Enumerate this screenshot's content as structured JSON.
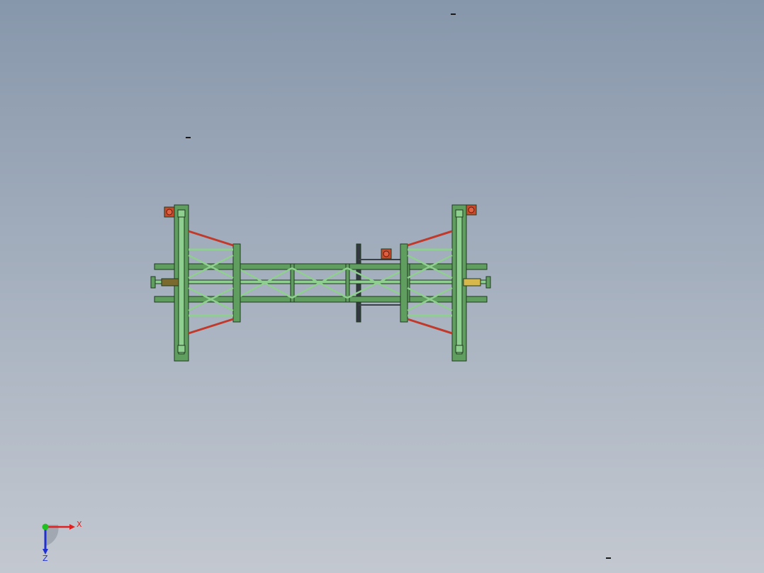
{
  "viewport": {
    "background_top": "#8797ab",
    "background_bottom": "#c3c8d0"
  },
  "model": {
    "frame_color": "#5f9e5f",
    "frame_light": "#8fcf8f",
    "outline_color": "#1e3a1e",
    "brace_red": "#c0392b",
    "clamp_left_color": "#7a6a2e",
    "clamp_right_color": "#d8b84a",
    "bolt_color": "#c94a2a"
  },
  "triad": {
    "x_label": "X",
    "z_label": "Z",
    "x_color": "#e02020",
    "y_color": "#20c020",
    "z_color": "#2030d0"
  }
}
